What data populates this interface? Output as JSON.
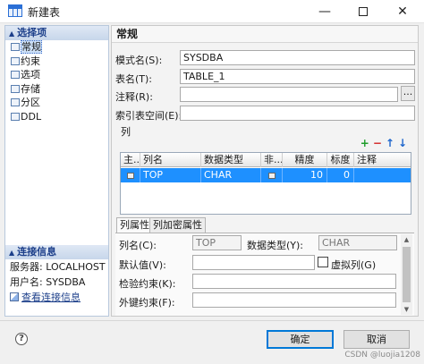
{
  "window": {
    "title": "新建表"
  },
  "sidebar": {
    "section_label": "选择项",
    "items": [
      {
        "label": "常规",
        "selected": true
      },
      {
        "label": "约束"
      },
      {
        "label": "选项"
      },
      {
        "label": "存储"
      },
      {
        "label": "分区"
      },
      {
        "label": "DDL"
      }
    ],
    "connection": {
      "section_label": "连接信息",
      "server_label": "服务器:",
      "server_value": "LOCALHOST",
      "user_label": "用户名:",
      "user_value": "SYSDBA",
      "view_link": "查看连接信息"
    }
  },
  "main": {
    "header": "常规",
    "schema": {
      "label": "模式名(S):",
      "value": "SYSDBA"
    },
    "table_name": {
      "label": "表名(T):",
      "value": "TABLE_1"
    },
    "comment": {
      "label": "注释(R):",
      "value": "",
      "browse_label": "..."
    },
    "tablespace": {
      "label": "索引表空间(E):",
      "value": ""
    },
    "columns_group": {
      "label": "列",
      "headers": [
        "主...",
        "列名",
        "数据类型",
        "非...",
        "精度",
        "标度",
        "注释"
      ],
      "rows": [
        {
          "name": "TOP",
          "type": "CHAR",
          "precision": "10",
          "scale": "0",
          "comment": ""
        }
      ]
    },
    "property_tabs": [
      "列属性",
      "列加密属性"
    ],
    "column_props": {
      "name_label": "列名(C):",
      "name_value": "TOP",
      "type_label": "数据类型(Y):",
      "type_value": "CHAR",
      "default_label": "默认值(V):",
      "virtual_label": "虚拟列(G)",
      "check_label": "检验约束(K):",
      "fk_label": "外键约束(F):"
    }
  },
  "footer": {
    "help_label": "?",
    "ok_label": "确定",
    "cancel_label": "取消",
    "watermark": "CSDN @luojia1208"
  },
  "colors": {
    "selection": "#1e90ff",
    "link": "#1c3f8a",
    "add": "#1f9d2b",
    "delete": "#d22222",
    "arrow": "#1e66cc"
  }
}
